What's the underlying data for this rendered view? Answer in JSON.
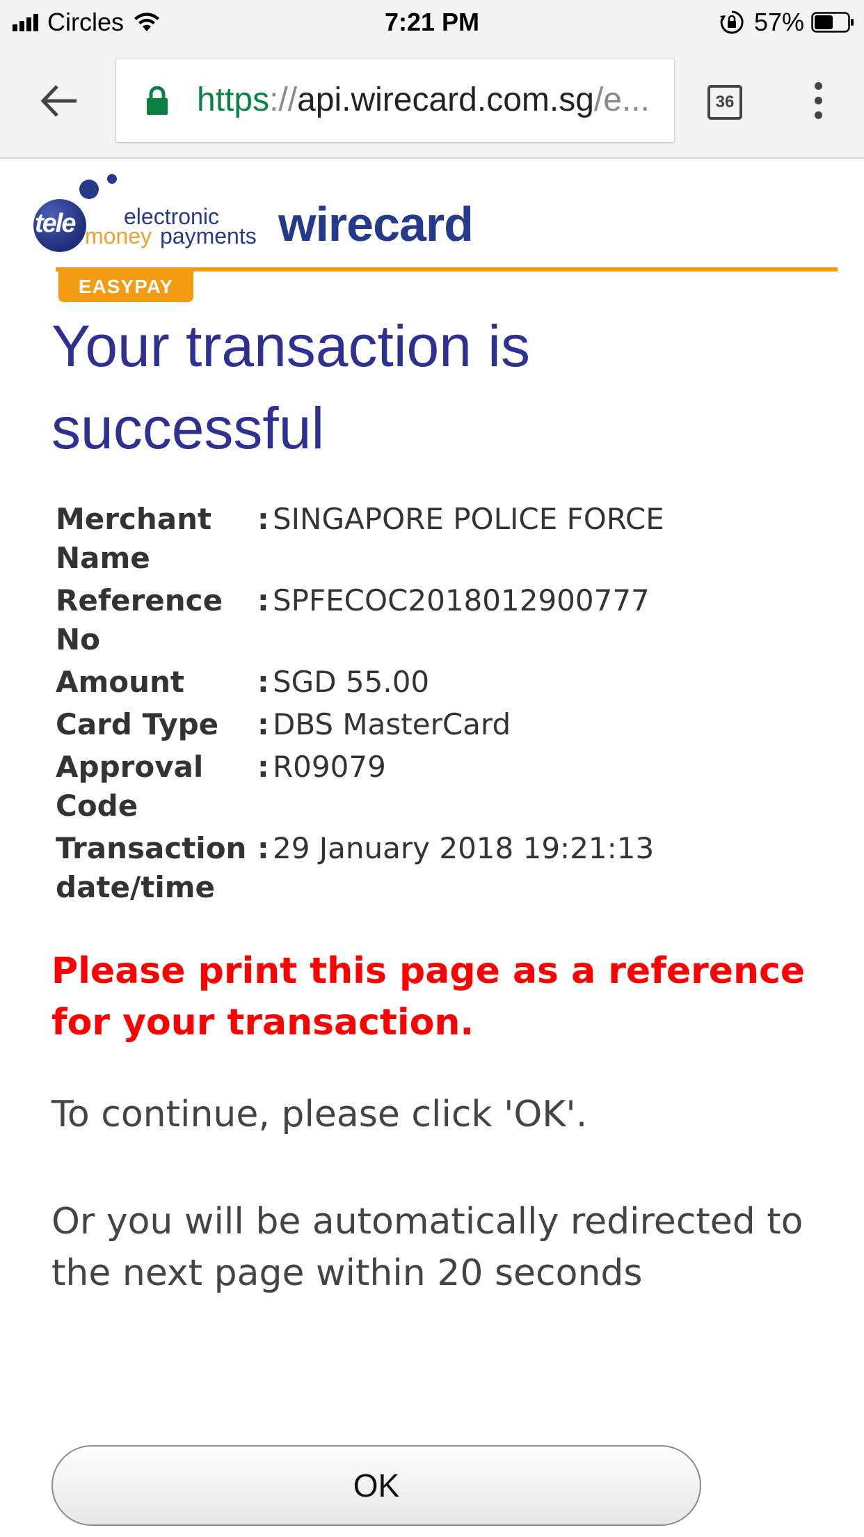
{
  "status_bar": {
    "carrier": "Circles",
    "time": "7:21 PM",
    "battery_percent": "57%",
    "battery_level": 0.57
  },
  "browser": {
    "url_scheme": "https",
    "url_separator": "://",
    "url_host": "api.wirecard.com.sg",
    "url_rest": "/e...",
    "tab_count": "36"
  },
  "branding": {
    "tele_logo": "tele",
    "electronic": "electronic",
    "money": "money",
    "payments": "payments",
    "wirecard": "wirecard",
    "easypay_tab": "EASYPAY",
    "accent_color": "#f39c12",
    "brand_color": "#263a8c"
  },
  "page": {
    "headline": "Your transaction is successful",
    "details": [
      {
        "label": "Merchant Name",
        "value": "SINGAPORE POLICE FORCE"
      },
      {
        "label": "Reference No",
        "value": "SPFECOC2018012900777"
      },
      {
        "label": "Amount",
        "value": "SGD 55.00"
      },
      {
        "label": "Card Type",
        "value": "DBS MasterCard"
      },
      {
        "label": "Approval Code",
        "value": "R09079"
      },
      {
        "label": "Transaction date/time",
        "value": "29 January 2018 19:21:13"
      }
    ],
    "colon": ":",
    "print_note": "Please print this page as a reference for your transaction.",
    "continue_note": "To continue, please click 'OK'.",
    "redirect_note": "Or you will be automatically redirected to the next page within 20 seconds",
    "ok_button": "OK"
  }
}
